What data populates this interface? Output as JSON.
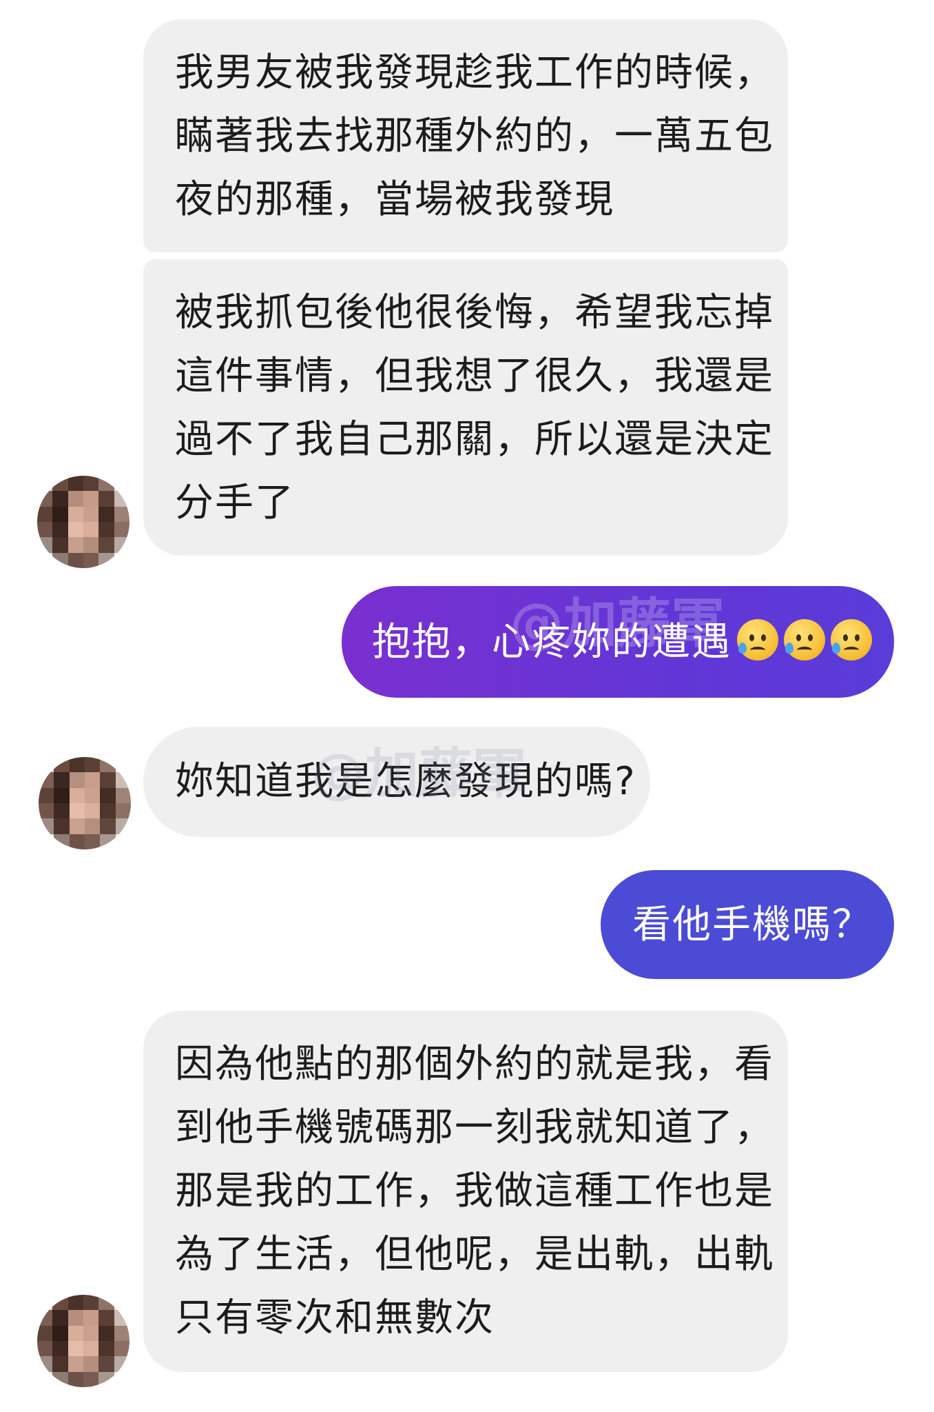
{
  "messages": [
    {
      "lines": [
        "我男友被我發現趁我工作的時候，",
        "瞞著我去找那種外約的，一萬五包",
        "夜的那種，當場被我發現"
      ]
    },
    {
      "lines": [
        "被我抓包後他很後悔，希望我忘掉",
        "這件事情，但我想了很久，我還是",
        "過不了我自己那關，所以還是決定",
        "分手了"
      ]
    },
    {
      "text": "抱抱，心疼妳的遭遇"
    },
    {
      "text": "妳知道我是怎麼發現的嗎?"
    },
    {
      "text": "看他手機嗎？"
    },
    {
      "lines": [
        "因為他點的那個外約的就是我，看",
        "到他手機號碼那一刻我就知道了，",
        "那是我的工作，我做這種工作也是",
        "為了生活，但他呢，是出軌，出軌",
        "只有零次和無數次"
      ]
    }
  ],
  "watermark": "@加藤軍",
  "emojis": [
    "sad-tear-emoji",
    "sad-tear-emoji",
    "sad-tear-emoji"
  ],
  "colors": {
    "incoming_bubble": "#efefef",
    "outgoing_gradient_start": "#7a2fd0",
    "outgoing_gradient_end": "#4a4bd8",
    "outgoing_solid": "#4b4bd6"
  }
}
